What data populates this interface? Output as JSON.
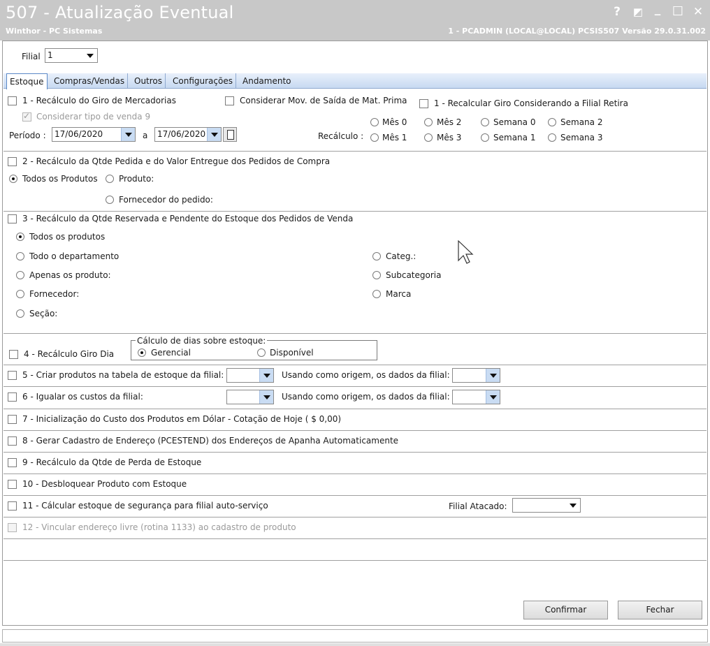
{
  "window": {
    "title": "507 - Atualização Eventual",
    "subtitle": "Winthor - PC Sistemas",
    "user_info": "1 - PCADMIN (LOCAL@LOCAL)   PCSIS507   Versão  29.0.31.002",
    "help_glyph": "?",
    "restore_glyph": "◩",
    "minimize_glyph": "_",
    "maximize_glyph": "☐",
    "close_glyph": "✕"
  },
  "filial": {
    "label": "Filial",
    "value": "1"
  },
  "tabs": [
    {
      "label": "Estoque",
      "active": true
    },
    {
      "label": "Compras/Vendas",
      "active": false
    },
    {
      "label": "Outros",
      "active": false
    },
    {
      "label": "Configurações",
      "active": false
    },
    {
      "label": "Andamento",
      "active": false
    }
  ],
  "sec1": {
    "recalc_giro": "1 - Recálculo do Giro de Mercadorias",
    "considerar_mov": "Considerar Mov. de Saída de Mat. Prima",
    "recalc_filial_retira": "1 - Recalcular Giro Considerando a Filial Retira",
    "considerar_tipo_venda": "Considerar tipo de venda 9",
    "periodo_label": "Período :",
    "date_from": "17/06/2020",
    "a_label": "a",
    "date_to": "17/06/2020",
    "recalculo_label": "Recálculo :",
    "options": [
      "Mês 0",
      "Mês 2",
      "Semana 0",
      "Semana 2",
      "Mês 1",
      "Mês 3",
      "Semana 1",
      "Semana 3"
    ]
  },
  "sec2": {
    "title": "2 - Recálculo da Qtde Pedida e do Valor Entregue dos Pedidos de Compra",
    "todos": "Todos os Produtos",
    "produto": "Produto:",
    "fornecedor": "Fornecedor do pedido:"
  },
  "sec3": {
    "title": "3 - Recálculo da Qtde Reservada e Pendente do Estoque dos Pedidos de Venda",
    "todos": "Todos os produtos",
    "departamento": "Todo o departamento",
    "apenas": "Apenas os produto:",
    "fornecedor": "Fornecedor:",
    "secao": "Seção:",
    "categ": "Categ.:",
    "subcategoria": "Subcategoria",
    "marca": "Marca"
  },
  "sec4": {
    "title": "4 - Recálculo Giro Dia",
    "group_title": "Cálculo de dias sobre estoque:",
    "gerencial": "Gerencial",
    "disponivel": "Disponível"
  },
  "sec5": {
    "title": "5 - Criar produtos na tabela de estoque da filial:",
    "origem": "Usando como origem, os dados da filial:"
  },
  "sec6": {
    "title": "6 - Igualar os custos da filial:",
    "origem": "Usando como origem, os dados da filial:"
  },
  "sec7": {
    "title": "7 - Inicialização do Custo dos Produtos em Dólar - Cotação de Hoje ( $ 0,00)"
  },
  "sec8": {
    "title": "8 - Gerar Cadastro de Endereço (PCESTEND) dos Endereços de Apanha Automaticamente"
  },
  "sec9": {
    "title": "9 - Recálculo da Qtde de Perda de Estoque"
  },
  "sec10": {
    "title": "10 - Desbloquear Produto com Estoque"
  },
  "sec11": {
    "title": "11 - Cálcular estoque de segurança para filial auto-serviço",
    "filial_atacado": "Filial Atacado:"
  },
  "sec12": {
    "title": "12 - Vincular endereço livre (rotina 1133) ao cadastro de produto"
  },
  "buttons": {
    "confirmar": "Confirmar",
    "fechar": "Fechar"
  },
  "colors": {
    "titlebar": "#c8c8c8",
    "tab_active_border": "#5b89c7",
    "dropdown_blue": "#c9dcf3"
  }
}
